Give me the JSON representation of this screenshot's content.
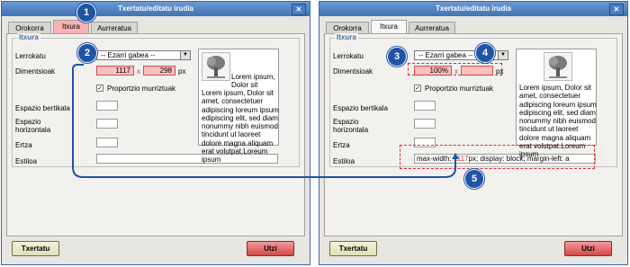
{
  "left": {
    "title": "Txertatu/editatu irudia",
    "close": "✕",
    "tabs": [
      "Orokorra",
      "Itxura",
      "Aurreratua"
    ],
    "legend": "Itxura",
    "labels": {
      "align": "Lerrokatu",
      "dims": "Dimentsioak",
      "vspace": "Espazio bertikala",
      "hspace": "Espazio horizontala",
      "border": "Ertza",
      "style": "Estiloa"
    },
    "align_value": "-- Ezarri gabea --",
    "width": "1117",
    "height": "298",
    "times": "x",
    "px": "px",
    "constrain": "Proportzio murriztuak",
    "lorem": "Lorem ipsum, Dolor sit amet, consectetuer adipiscing loreum ipsum edipiscing elit, sed diam nonummy nibh euismod tincidunt ut laoreet dolore magna aliquam erat volutpat.Loreum ipsum",
    "insert": "Txertatu",
    "cancel": "Utzi"
  },
  "right": {
    "title": "Txertatu/editatu irudia",
    "close": "✕",
    "tabs": [
      "Orokorra",
      "Itxura",
      "Aurreratua"
    ],
    "legend": "Itxura",
    "labels": {
      "align": "Lerrokatu",
      "dims": "Dimentsioak",
      "vspace": "Espazio bertikala",
      "hspace": "Espazio horizontala",
      "border": "Ertza",
      "style": "Estiloa"
    },
    "align_value": "-- Ezarri gabea --",
    "width": "100%",
    "height": "",
    "times": "x",
    "px": "px",
    "constrain": "Proportzio murriztuak",
    "lorem": "Lorem ipsum, Dolor sit amet, consectetuer adipiscing loreum ipsum edipiscing elit, sed diam nonummy nibh euismod tincidunt ut laoreet dolore magna aliquam erat volutpat.Loreum ipsum",
    "style_pre": "max-width: ",
    "style_hl": "1117",
    "style_post": "px; display: block; margin-left: a",
    "insert": "Txertatu",
    "cancel": "Utzi"
  },
  "badges": [
    "1",
    "2",
    "3",
    "4",
    "5"
  ],
  "colors": {
    "badge": "#1f54a6",
    "highlight": "#f9c0c0",
    "accent": "#4a6ea9"
  }
}
